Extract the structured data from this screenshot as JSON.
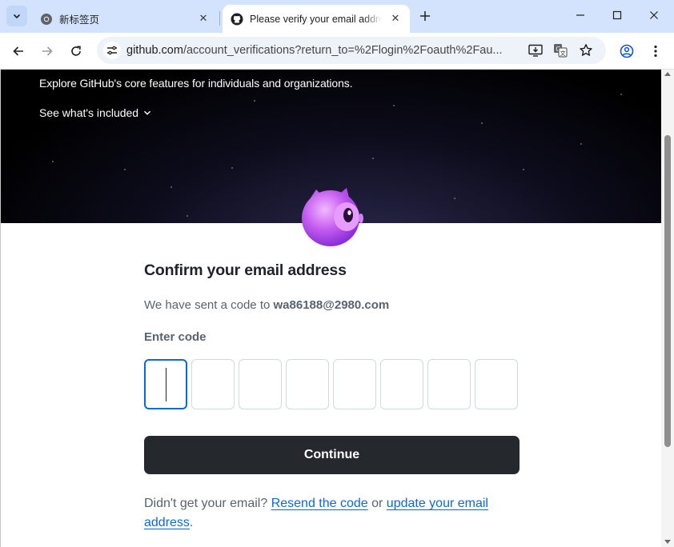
{
  "browser": {
    "tabs": [
      {
        "title": "新标签页",
        "active": false,
        "icon": "chrome-icon"
      },
      {
        "title": "Please verify your email address",
        "active": true,
        "icon": "github-icon"
      }
    ],
    "url_host": "github.com",
    "url_rest": "/account_verifications?return_to=%2Flogin%2Foauth%2Fau...",
    "accent": "#d3e3fd"
  },
  "hero": {
    "tagline": "Explore GitHub's core features for individuals and organizations.",
    "link": "See what's included"
  },
  "verify": {
    "heading": "Confirm your email address",
    "sent_prefix": "We have sent a code to ",
    "email": "wa86188@2980.com",
    "code_label": "Enter code",
    "code_boxes": 8,
    "continue_label": "Continue",
    "help_prefix": "Didn't get your email? ",
    "resend_link": "Resend the code",
    "help_or": " or ",
    "update_link": "update your email address",
    "help_suffix": "."
  }
}
